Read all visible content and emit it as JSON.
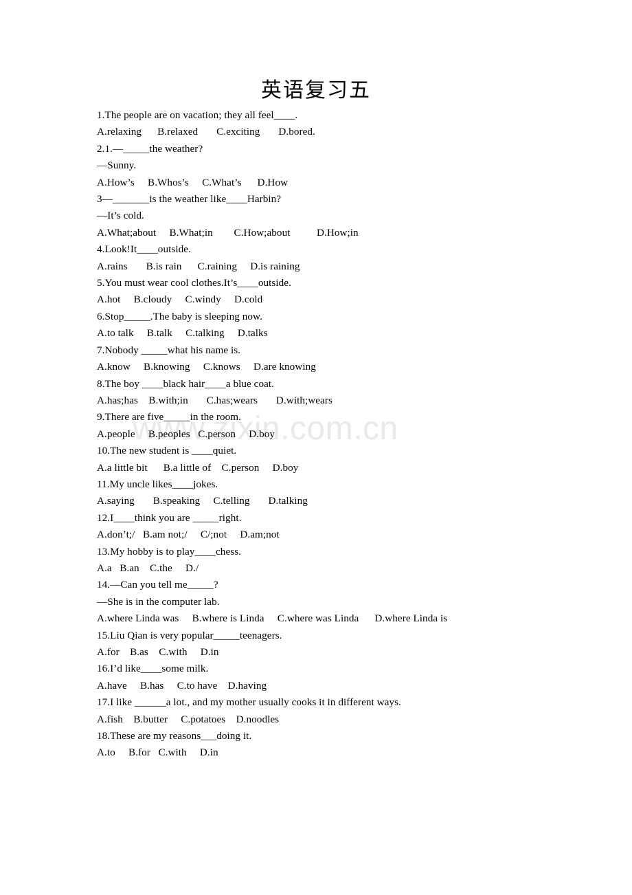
{
  "document": {
    "title": "英语复习五",
    "watermark": "www.zixin.com.cn",
    "watermark_color": "#e9e9e9",
    "text_color": "#000000",
    "background_color": "#ffffff"
  },
  "lines": [
    "1.The people are on vacation; they all feel____.",
    "A.relaxing      B.relaxed       C.exciting       D.bored.",
    "2.1.—_____the weather?",
    "—Sunny.",
    "A.How’s     B.Whos’s     C.What’s      D.How",
    "3—_______is the weather like____Harbin?",
    "—It’s cold.",
    "A.What;about     B.What;in        C.How;about          D.How;in",
    "4.Look!It____outside.",
    "A.rains       B.is rain      C.raining     D.is raining",
    "5.You must wear cool clothes.It’s____outside.",
    "A.hot     B.cloudy     C.windy     D.cold",
    "6.Stop_____.The baby is sleeping now.",
    "A.to talk     B.talk     C.talking     D.talks",
    "7.Nobody _____what his name is.",
    "A.know     B.knowing     C.knows     D.are knowing",
    "8.The boy ____black hair____a blue coat.",
    "A.has;has    B.with;in       C.has;wears       D.with;wears",
    "9.There are five_____in the room.",
    "A.people     B.peoples   C.person     D.boy",
    "10.The new student is ____quiet.",
    "A.a little bit      B.a little of    C.person     D.boy",
    "11.My uncle likes____jokes.",
    "A.saying       B.speaking     C.telling       D.talking",
    "12.I____think you are _____right.",
    "A.don’t;/   B.am not;/     C/;not     D.am;not",
    "13.My hobby is to play____chess.",
    "A.a   B.an    C.the     D./",
    "14.—Can you tell me_____?",
    "—She is in the computer lab.",
    "A.where Linda was     B.where is Linda     C.where was Linda      D.where Linda is",
    "15.Liu Qian is very popular_____teenagers.",
    "A.for    B.as    C.with     D.in",
    "16.I’d like____some milk.",
    "A.have     B.has     C.to have    D.having",
    "17.I like ______a lot., and my mother usually cooks it in different ways.",
    "A.fish    B.butter     C.potatoes    D.noodles",
    "18.These are my reasons___doing it.",
    "A.to     B.for   C.with     D.in"
  ]
}
